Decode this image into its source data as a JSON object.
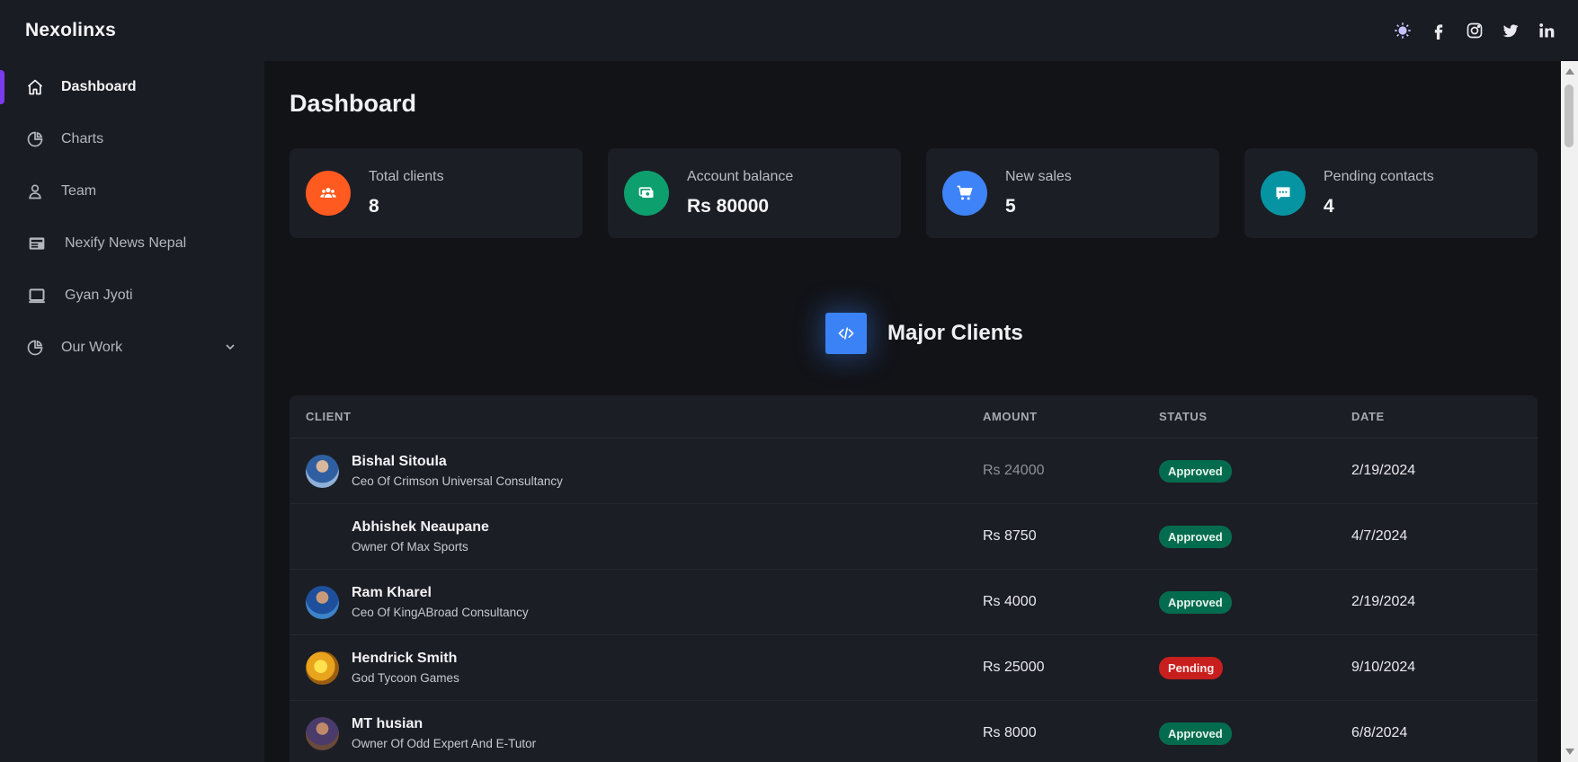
{
  "app": {
    "brand": "Nexolinxs"
  },
  "header": {
    "icons": [
      "sun-icon",
      "facebook-icon",
      "instagram-icon",
      "twitter-icon",
      "linkedin-icon"
    ]
  },
  "sidebar": {
    "items": [
      {
        "label": "Dashboard",
        "icon": "home-icon",
        "active": true
      },
      {
        "label": "Charts",
        "icon": "pie-chart-icon"
      },
      {
        "label": "Team",
        "icon": "user-icon"
      },
      {
        "label": "Nexify News Nepal",
        "icon": "newspaper-icon"
      },
      {
        "label": "Gyan Jyoti",
        "icon": "laptop-icon"
      },
      {
        "label": "Our Work",
        "icon": "pie-chart-icon",
        "expandable": true
      }
    ]
  },
  "main": {
    "title": "Dashboard",
    "cards": [
      {
        "label": "Total clients",
        "value": "8",
        "icon": "users-icon",
        "color": "#ff5a1f"
      },
      {
        "label": "Account balance",
        "value": "Rs 80000",
        "icon": "cash-icon",
        "color": "#0e9f6e"
      },
      {
        "label": "New sales",
        "value": "5",
        "icon": "cart-icon",
        "color": "#3f83f8"
      },
      {
        "label": "Pending contacts",
        "value": "4",
        "icon": "chat-icon",
        "color": "#0694a2"
      }
    ],
    "section_title": "Major Clients",
    "table": {
      "headers": [
        "CLIENT",
        "AMOUNT",
        "STATUS",
        "DATE"
      ],
      "rows": [
        {
          "name": "Bishal Sitoula",
          "role": "Ceo Of Crimson Universal Consultancy",
          "amount": "Rs 24000",
          "status": "Approved",
          "date": "2/19/2024"
        },
        {
          "name": "Abhishek Neaupane",
          "role": "Owner Of Max Sports",
          "amount": "Rs 8750",
          "status": "Approved",
          "date": "4/7/2024"
        },
        {
          "name": "Ram Kharel",
          "role": "Ceo Of KingABroad Consultancy",
          "amount": "Rs 4000",
          "status": "Approved",
          "date": "2/19/2024"
        },
        {
          "name": "Hendrick Smith",
          "role": "God Tycoon Games",
          "amount": "Rs 25000",
          "status": "Pending",
          "date": "9/10/2024"
        },
        {
          "name": "MT husian",
          "role": "Owner Of Odd Expert And E-Tutor",
          "amount": "Rs 8000",
          "status": "Approved",
          "date": "6/8/2024"
        }
      ]
    }
  },
  "colors": {
    "active_indicator": "#7c3aed",
    "section_icon": "#3b82f6",
    "approved": "#046c4e",
    "pending": "#c81e1e"
  }
}
